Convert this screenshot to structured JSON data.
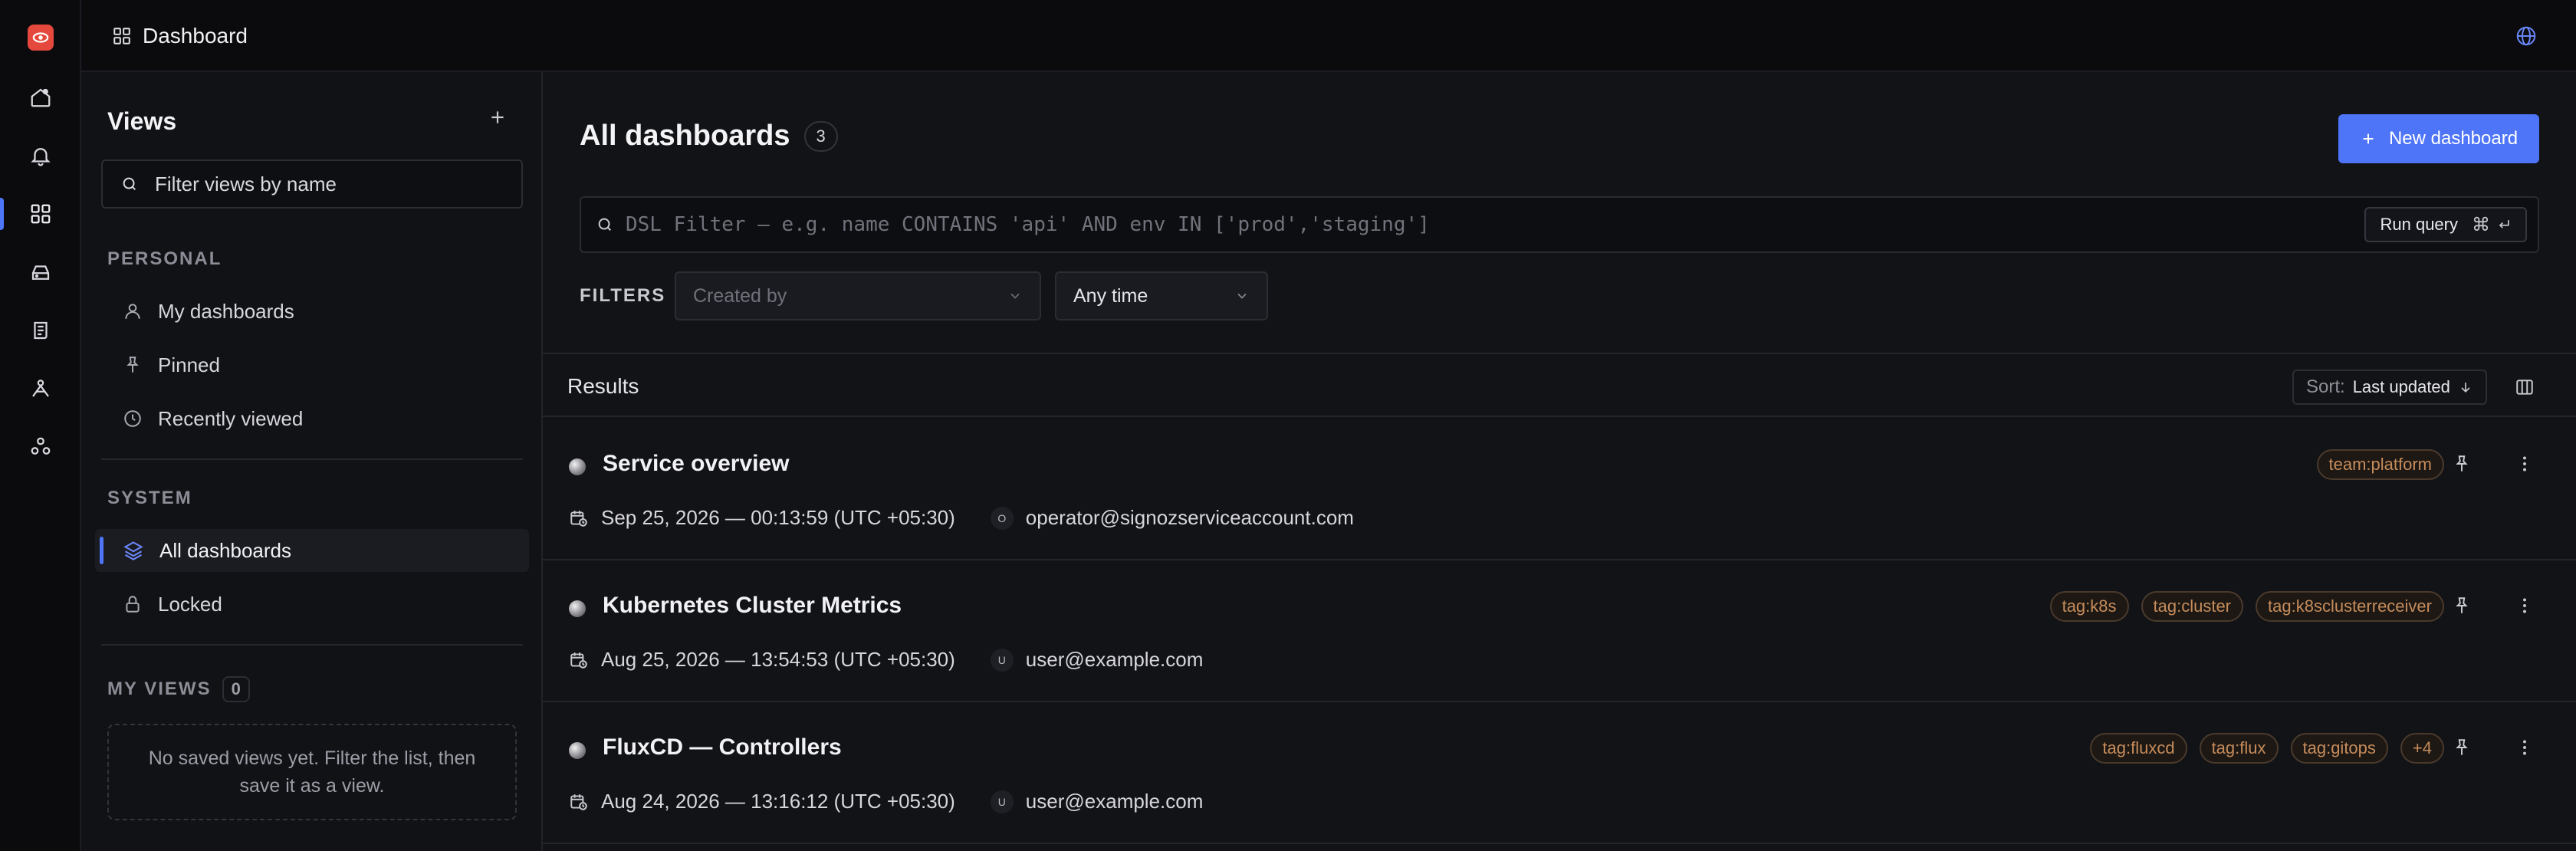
{
  "topbar": {
    "title": "Dashboard"
  },
  "views": {
    "title": "Views",
    "search_placeholder": "Filter views by name",
    "personal_label": "PERSONAL",
    "personal_items": [
      {
        "label": "My dashboards",
        "icon": "user-icon"
      },
      {
        "label": "Pinned",
        "icon": "pin-icon"
      },
      {
        "label": "Recently viewed",
        "icon": "clock-icon"
      }
    ],
    "system_label": "SYSTEM",
    "system_items": [
      {
        "label": "All dashboards",
        "icon": "layers-icon",
        "active": true
      },
      {
        "label": "Locked",
        "icon": "lock-icon"
      }
    ],
    "my_views_label": "MY VIEWS",
    "my_views_count": "0",
    "empty_text": "No saved views yet. Filter the list, then save it as a view."
  },
  "main": {
    "title": "All dashboards",
    "count": "3",
    "new_button": "New dashboard",
    "dsl_placeholder": "DSL Filter — e.g. name CONTAINS 'api' AND env IN ['prod','staging']",
    "run_query": "Run query",
    "filters_label": "FILTERS",
    "created_by_placeholder": "Created by",
    "time_value": "Any time",
    "results_label": "Results",
    "sort_label": "Sort:",
    "sort_value": "Last updated"
  },
  "rows": [
    {
      "title": "Service overview",
      "date": "Sep 25, 2026 — 00:13:59 (UTC +05:30)",
      "avatar": "O",
      "user": "operator@signozserviceaccount.com",
      "tags": [
        "team:platform"
      ]
    },
    {
      "title": "Kubernetes Cluster Metrics",
      "date": "Aug 25, 2026 — 13:54:53 (UTC +05:30)",
      "avatar": "U",
      "user": "user@example.com",
      "tags": [
        "tag:k8s",
        "tag:cluster",
        "tag:k8sclusterreceiver"
      ]
    },
    {
      "title": "FluxCD — Controllers",
      "date": "Aug 24, 2026 — 13:16:12 (UTC +05:30)",
      "avatar": "U",
      "user": "user@example.com",
      "tags": [
        "tag:fluxcd",
        "tag:flux",
        "tag:gitops",
        "+4"
      ]
    }
  ],
  "colors": {
    "accent": "#4e74f8",
    "brand": "#e5483d",
    "tag_text": "#c68c5b"
  }
}
